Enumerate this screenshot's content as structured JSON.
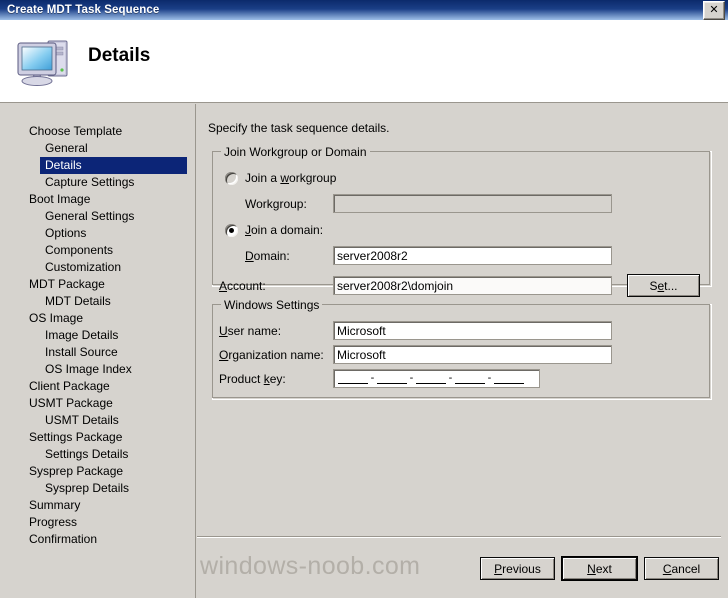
{
  "window": {
    "title": "Create MDT Task Sequence",
    "close_label": "✕"
  },
  "header": {
    "title": "Details",
    "icon": "computer-icon"
  },
  "sidebar": {
    "items": [
      {
        "label": "Choose Template",
        "level": 0,
        "selected": false
      },
      {
        "label": "General",
        "level": 1,
        "selected": false
      },
      {
        "label": "Details",
        "level": 1,
        "selected": true
      },
      {
        "label": "Capture Settings",
        "level": 1,
        "selected": false
      },
      {
        "label": "Boot Image",
        "level": 0,
        "selected": false
      },
      {
        "label": "General Settings",
        "level": 1,
        "selected": false
      },
      {
        "label": "Options",
        "level": 1,
        "selected": false
      },
      {
        "label": "Components",
        "level": 1,
        "selected": false
      },
      {
        "label": "Customization",
        "level": 1,
        "selected": false
      },
      {
        "label": "MDT Package",
        "level": 0,
        "selected": false
      },
      {
        "label": "MDT Details",
        "level": 1,
        "selected": false
      },
      {
        "label": "OS Image",
        "level": 0,
        "selected": false
      },
      {
        "label": "Image Details",
        "level": 1,
        "selected": false
      },
      {
        "label": "Install Source",
        "level": 1,
        "selected": false
      },
      {
        "label": "OS Image Index",
        "level": 1,
        "selected": false
      },
      {
        "label": "Client Package",
        "level": 0,
        "selected": false
      },
      {
        "label": "USMT Package",
        "level": 0,
        "selected": false
      },
      {
        "label": "USMT Details",
        "level": 1,
        "selected": false
      },
      {
        "label": "Settings Package",
        "level": 0,
        "selected": false
      },
      {
        "label": "Settings Details",
        "level": 1,
        "selected": false
      },
      {
        "label": "Sysprep Package",
        "level": 0,
        "selected": false
      },
      {
        "label": "Sysprep Details",
        "level": 1,
        "selected": false
      },
      {
        "label": "Summary",
        "level": 0,
        "selected": false
      },
      {
        "label": "Progress",
        "level": 0,
        "selected": false
      },
      {
        "label": "Confirmation",
        "level": 0,
        "selected": false
      }
    ]
  },
  "main": {
    "intro": "Specify the task sequence details.",
    "join_group": {
      "legend": "Join Workgroup or Domain",
      "radio_workgroup": {
        "label_before": "Join a ",
        "label_key": "w",
        "label_after": "orkgroup",
        "checked": false
      },
      "workgroup_label": "Workgroup:",
      "workgroup_value": "",
      "workgroup_disabled": true,
      "radio_domain": {
        "label_before": "",
        "label_key": "J",
        "label_after": "oin a domain:",
        "checked": true
      },
      "domain_label_before": "",
      "domain_label_key": "D",
      "domain_label_after": "omain:",
      "domain_value": "server2008r2",
      "account_label_key": "A",
      "account_label_after": "ccount:",
      "account_value": "server2008r2\\domjoin",
      "set_button_before": "S",
      "set_button_key": "e",
      "set_button_after": "t..."
    },
    "windows_group": {
      "legend": "Windows Settings",
      "username_label_key": "U",
      "username_label_after": "ser name:",
      "username_value": "Microsoft",
      "org_label_key": "O",
      "org_label_after": "rganization name:",
      "org_value": "Microsoft",
      "productkey_label_before": "Product ",
      "productkey_label_key": "k",
      "productkey_label_after": "ey:",
      "productkey_value": "",
      "productkey_mask": "_____-_____-_____-_____-_____"
    }
  },
  "footer": {
    "previous_before": "",
    "previous_key": "P",
    "previous_after": "revious",
    "next_before": "",
    "next_key": "N",
    "next_after": "ext",
    "cancel_before": "",
    "cancel_key": "C",
    "cancel_after": "ancel"
  },
  "watermark": {
    "text": "windows-noob.com"
  },
  "colors": {
    "titlebar": "#0b2a6b",
    "selection": "#0c2577",
    "face": "#d6d3ce",
    "field": "#ffffff"
  }
}
